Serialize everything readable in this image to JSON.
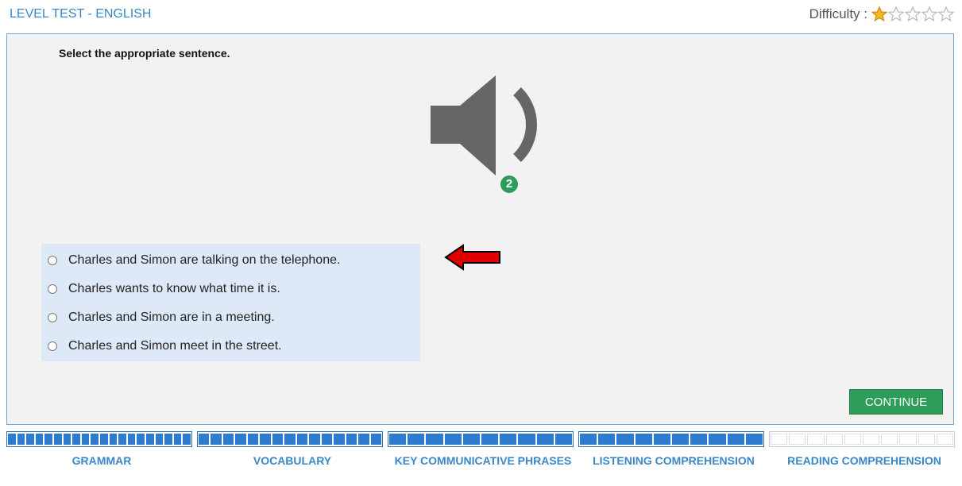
{
  "header": {
    "title": "LEVEL TEST - ENGLISH",
    "difficulty_label": "Difficulty :",
    "difficulty_rating": 1,
    "difficulty_max": 5
  },
  "question": {
    "prompt": "Select the appropriate sentence.",
    "audio_plays_remaining": "2",
    "options": [
      "Charles and Simon are talking on the telephone.",
      "Charles wants to know what time it is.",
      "Charles and Simon are in a meeting.",
      "Charles and Simon meet in the street."
    ]
  },
  "actions": {
    "continue_label": "CONTINUE"
  },
  "colors": {
    "accent": "#3a87c8",
    "continue": "#2d9e5a",
    "progress_fill": "#2f7bd0",
    "arrow": "#e00000"
  },
  "progress": {
    "sections": [
      {
        "label": "GRAMMAR",
        "completed": 20,
        "total": 20
      },
      {
        "label": "VOCABULARY",
        "completed": 15,
        "total": 15
      },
      {
        "label": "KEY COMMUNICATIVE PHRASES",
        "completed": 10,
        "total": 10
      },
      {
        "label": "LISTENING COMPREHENSION",
        "completed": 10,
        "total": 10
      },
      {
        "label": "READING COMPREHENSION",
        "completed": 0,
        "total": 10
      }
    ]
  }
}
